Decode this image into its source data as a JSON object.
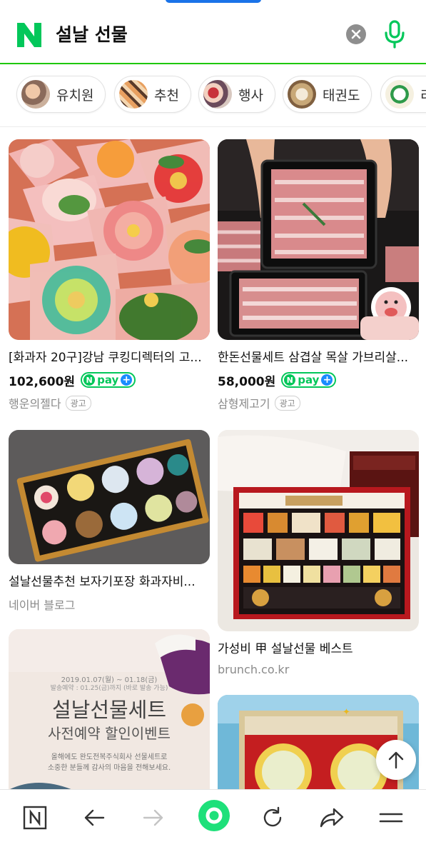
{
  "search": {
    "logo_letter": "N",
    "query": "설날 선물",
    "clear_icon": "close-circle-icon",
    "voice_icon": "microphone-icon"
  },
  "chips": [
    {
      "label": "유치원"
    },
    {
      "label": "추천"
    },
    {
      "label": "행사"
    },
    {
      "label": "태권도"
    },
    {
      "label": "리"
    }
  ],
  "results": [
    {
      "title": "[화과자 20구]강남 쿠킹디렉터의 고...",
      "price": "102,600원",
      "npay": "pay",
      "source": "행운의젤다",
      "ad_badge": "광고"
    },
    {
      "title": "한돈선물세트 삼겹살 목살 가브리살...",
      "price": "58,000원",
      "npay": "pay",
      "source": "삼형제고기",
      "ad_badge": "광고"
    },
    {
      "title": "설날선물추천 보자기포장 화과자비...",
      "source": "네이버 블로그"
    },
    {
      "title": "가성비 甲 설날선물 베스트",
      "source": "brunch.co.kr"
    },
    {
      "image_text": {
        "line1": "설날선물세트",
        "line2": "사전예약 할인이벤트",
        "dates": "2019.01.07(월) ~ 01.18(금)",
        "ship": "발송예약 : 01.25(금)까지 (바로 발송 가능)",
        "body1": "올해에도 완도전복주식회사 선물세트로",
        "body2": "소중한 분들께 감사의 마음을 전해보세요."
      }
    },
    {}
  ],
  "colors": {
    "naver_green": "#03c75a",
    "accent_line": "#1ec800",
    "npay_plus": "#1a8cff"
  },
  "bottom_nav": {
    "home_icon": "naver-home-icon",
    "back_icon": "back-arrow-icon",
    "forward_icon": "forward-arrow-icon",
    "green_dot_icon": "green-dot-icon",
    "refresh_icon": "refresh-icon",
    "share_icon": "share-icon",
    "menu_icon": "menu-icon"
  },
  "scroll_top_icon": "arrow-up-icon"
}
